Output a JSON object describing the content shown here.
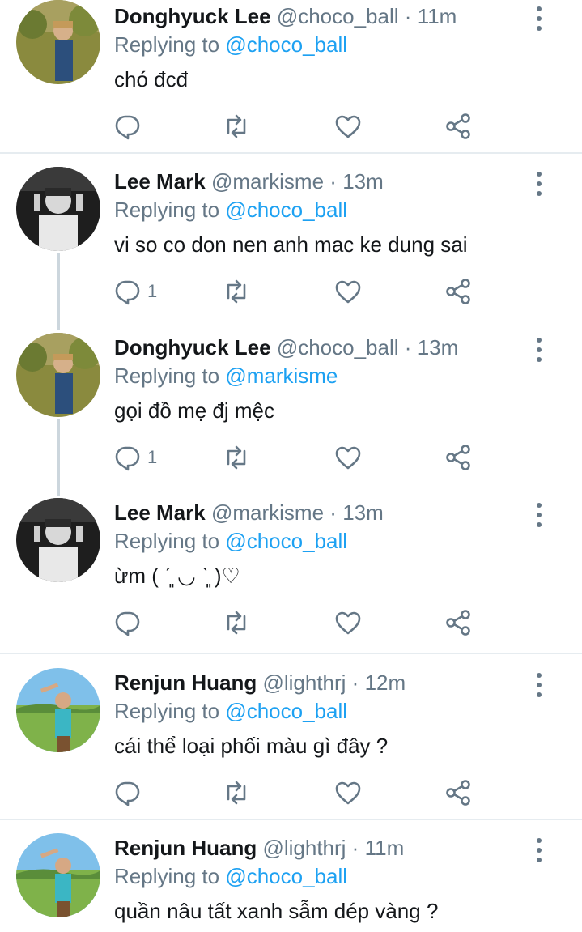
{
  "tweets": [
    {
      "name": "Donghyuck Lee",
      "handle": "@choco_ball",
      "time": "11m",
      "reply_prefix": "Replying to",
      "reply_to": "@choco_ball",
      "text": "chó đcđ",
      "reply_count": "",
      "avatar": "donghyuck"
    },
    {
      "name": "Lee Mark",
      "handle": "@markisme",
      "time": "13m",
      "reply_prefix": "Replying to",
      "reply_to": "@choco_ball",
      "text": "vi so co don nen anh mac ke dung sai",
      "reply_count": "1",
      "avatar": "mark"
    },
    {
      "name": "Donghyuck Lee",
      "handle": "@choco_ball",
      "time": "13m",
      "reply_prefix": "Replying to",
      "reply_to": "@markisme",
      "text": "gọi đồ mẹ đj mệc",
      "reply_count": "1",
      "avatar": "donghyuck"
    },
    {
      "name": "Lee Mark",
      "handle": "@markisme",
      "time": "13m",
      "reply_prefix": "Replying to",
      "reply_to": "@choco_ball",
      "text": "ừm ( ˊ͈ ◡ ˋ͈ )♡",
      "reply_count": "",
      "avatar": "mark"
    },
    {
      "name": "Renjun Huang",
      "handle": "@lighthrj",
      "time": "12m",
      "reply_prefix": "Replying to",
      "reply_to": "@choco_ball",
      "text": "cái thể loại phối màu gì đây ?",
      "reply_count": "",
      "avatar": "renjun"
    },
    {
      "name": "Renjun Huang",
      "handle": "@lighthrj",
      "time": "11m",
      "reply_prefix": "Replying to",
      "reply_to": "@choco_ball",
      "text": "quần nâu tất xanh sẫm dép vàng ?",
      "reply_count": "",
      "avatar": "renjun"
    }
  ],
  "separator": "·",
  "icons": {
    "reply": "reply-icon",
    "retweet": "retweet-icon",
    "like": "heart-icon",
    "share": "share-icon",
    "more": "more-vertical-icon"
  },
  "colors": {
    "link": "#1da1f2",
    "muted": "#657786",
    "divider": "#e6ecf0"
  }
}
